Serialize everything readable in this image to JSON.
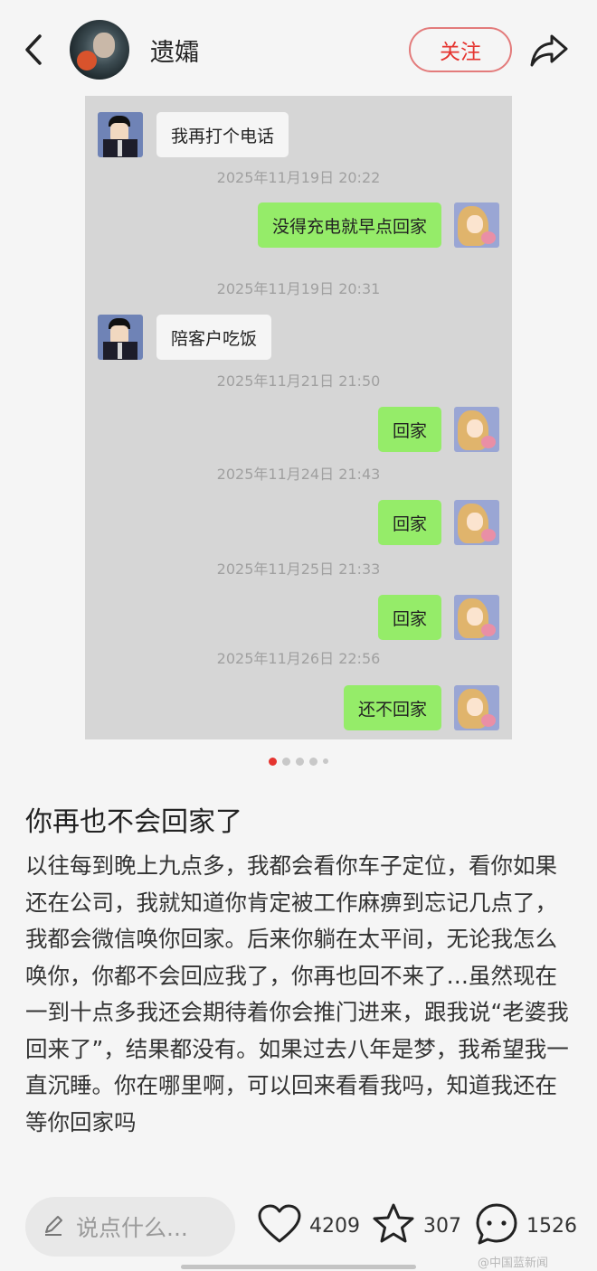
{
  "header": {
    "username": "遗孀",
    "follow_label": "关注"
  },
  "chat": {
    "messages": [
      {
        "side": "in",
        "text": "我再打个电话"
      },
      {
        "ts": "2025年11月19日 20:22"
      },
      {
        "side": "out",
        "text": "没得充电就早点回家"
      },
      {
        "ts": "2025年11月19日 20:31"
      },
      {
        "side": "in",
        "text": "陪客户吃饭"
      },
      {
        "ts": "2025年11月21日 21:50"
      },
      {
        "side": "out",
        "text": "回家"
      },
      {
        "ts": "2025年11月24日 21:43"
      },
      {
        "side": "out",
        "text": "回家"
      },
      {
        "ts": "2025年11月25日 21:33"
      },
      {
        "side": "out",
        "text": "回家"
      },
      {
        "ts": "2025年11月26日 22:56"
      },
      {
        "side": "out",
        "text": "还不回家"
      }
    ]
  },
  "pager": {
    "count": 5,
    "active": 1
  },
  "post": {
    "title": "你再也不会回家了",
    "body": "以往每到晚上九点多，我都会看你车子定位，看你如果还在公司，我就知道你肯定被工作麻痹到忘记几点了，我都会微信唤你回家。后来你躺在太平间，无论我怎么唤你，你都不会回应我了，你再也回不来了…虽然现在一到十点多我还会期待着你会推门进来，跟我说“老婆我回来了”，结果都没有。如果过去八年是梦，我希望我一直沉睡。你在哪里啊，可以回来看看我吗，知道我还在等你回家吗"
  },
  "bottom": {
    "comment_placeholder": "说点什么...",
    "likes": "4209",
    "favorites": "307",
    "comments": "1526"
  },
  "watermark": "@中国蓝新闻",
  "colors": {
    "accent": "#e5342f",
    "bubble_out": "#95ec69",
    "bubble_in": "#f5f5f5"
  }
}
